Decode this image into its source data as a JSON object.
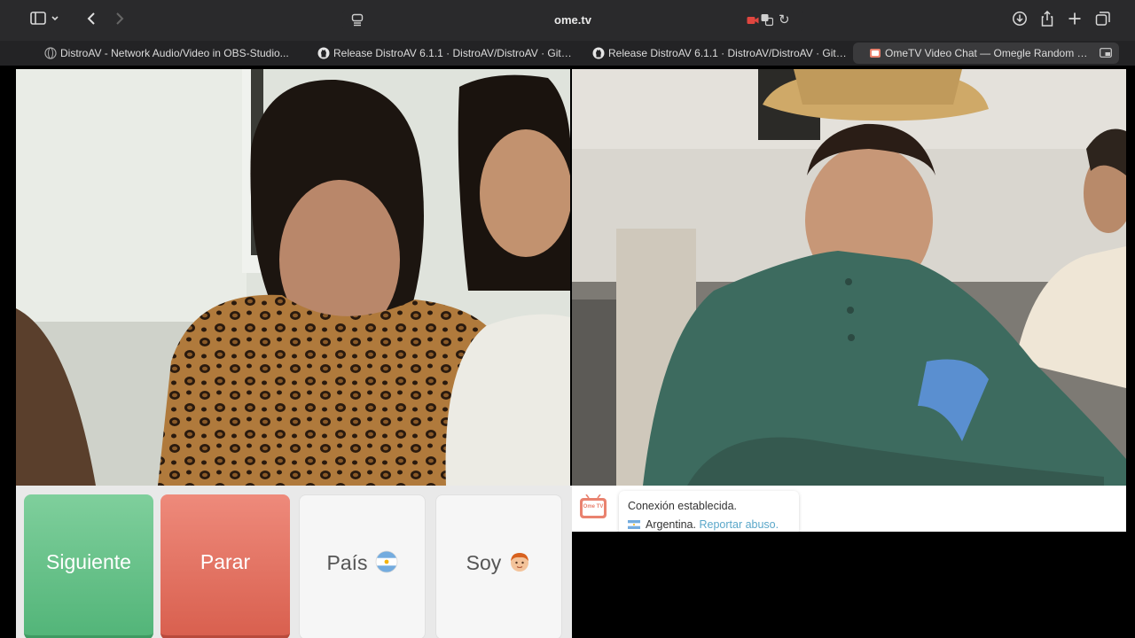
{
  "browser": {
    "address": "ome.tv",
    "tabs": [
      {
        "title": "DistroAV - Network Audio/Video in OBS-Studio..."
      },
      {
        "title": "Release DistroAV 6.1.1 · DistroAV/DistroAV · GitH..."
      },
      {
        "title": "Release DistroAV 6.1.1 · DistroAV/DistroAV · GitH..."
      },
      {
        "title": "OmeTV Video Chat — Omegle Random Ca..."
      }
    ],
    "icons": {
      "sidebar": "sidebar-icon",
      "back": "chevron-left-icon",
      "forward": "chevron-right-icon",
      "download": "download-icon",
      "share": "share-icon",
      "new_tab": "plus-icon",
      "tab_overview": "tabs-overview-icon"
    }
  },
  "controls": {
    "next_label": "Siguiente",
    "stop_label": "Parar",
    "country_label": "País",
    "gender_label": "Soy"
  },
  "chat": {
    "logo_text": "Ome TV",
    "status": "Conexión establecida.",
    "country": "Argentina.",
    "report_link": "Reportar abuso."
  },
  "colors": {
    "next": "#5dbb82",
    "stop": "#e06b5b",
    "link": "#5aa7c9",
    "recording": "#e0463f"
  }
}
